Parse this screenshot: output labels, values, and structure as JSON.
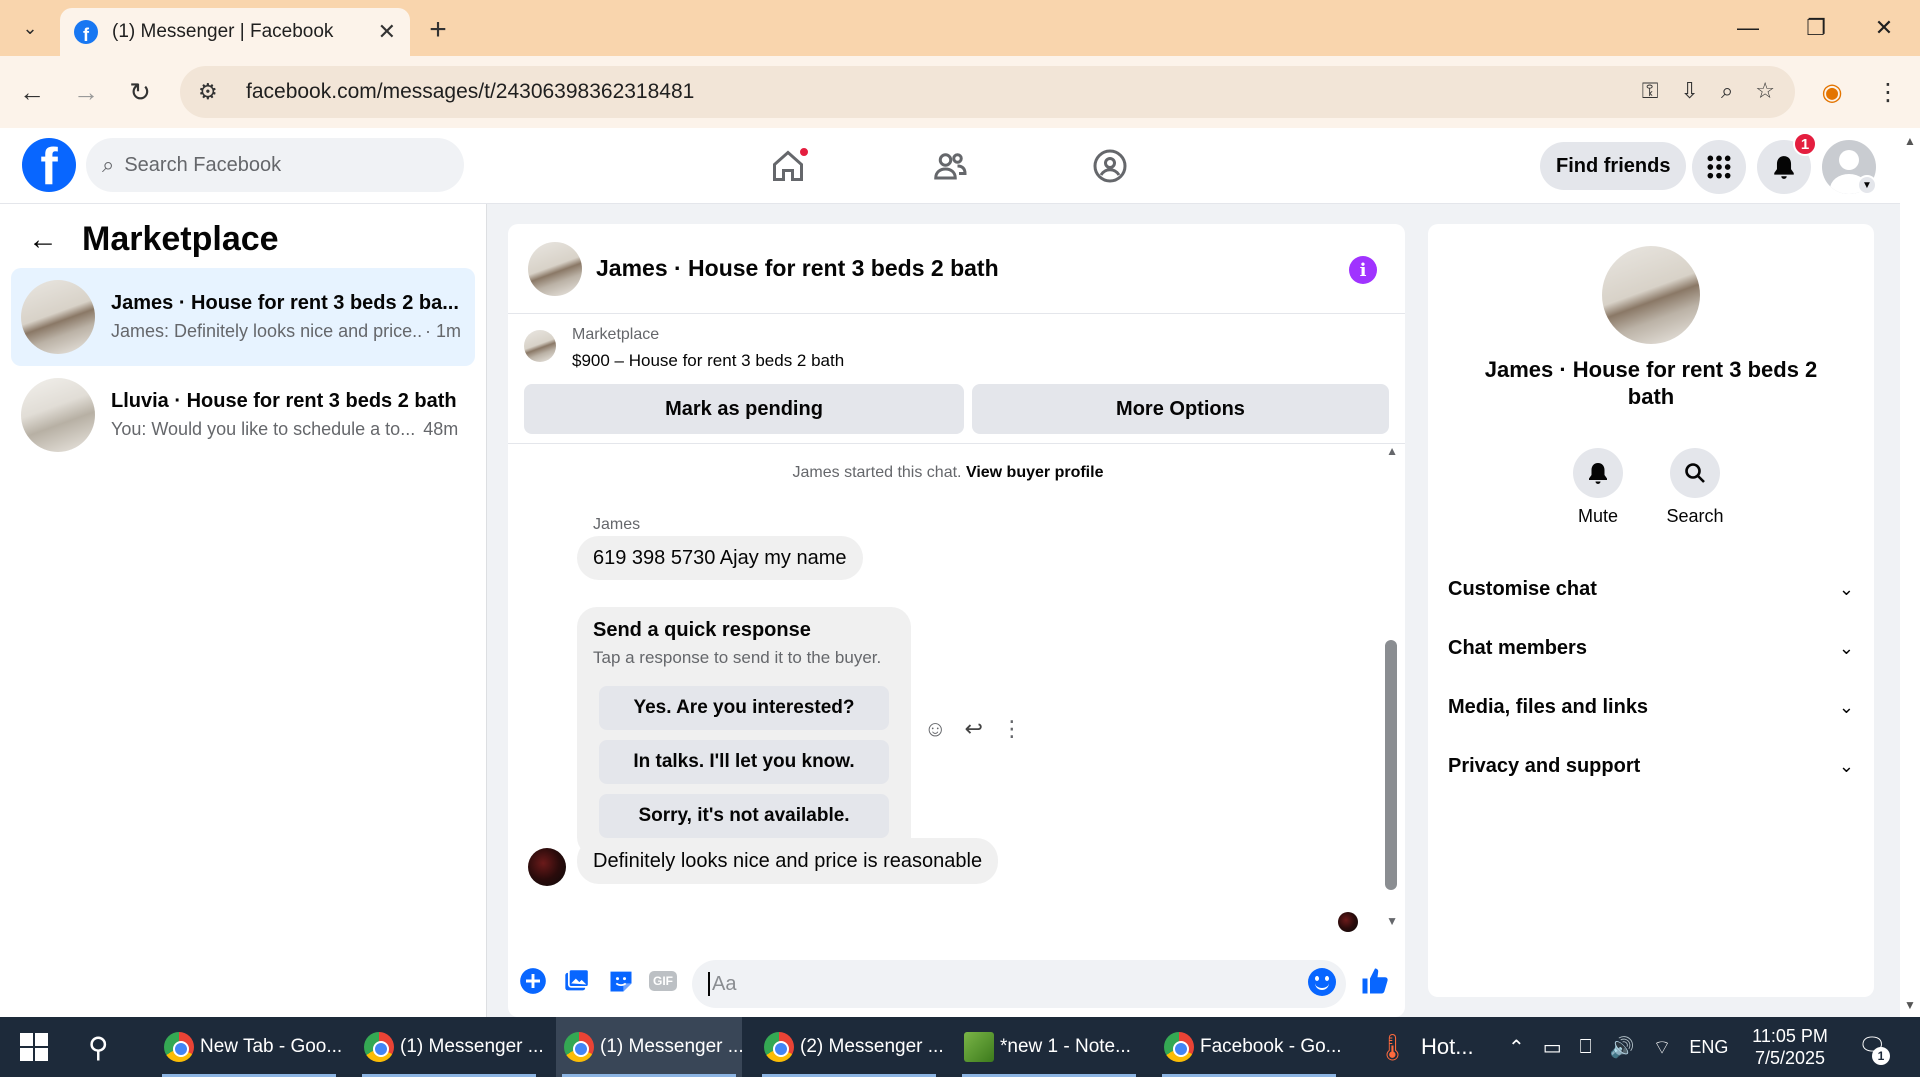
{
  "browser": {
    "tab_title": "(1) Messenger | Facebook",
    "url": "facebook.com/messages/t/24306398362318481"
  },
  "facebook": {
    "search_placeholder": "Search Facebook",
    "find_friends_label": "Find friends",
    "notifications_count": "1"
  },
  "sidebar": {
    "title": "Marketplace",
    "conversations": [
      {
        "name": "James · House for rent 3 beds 2 ba...",
        "snippet": "James: Definitely looks nice and price...",
        "time": "· 1m",
        "active": true
      },
      {
        "name": "Lluvia · House for rent 3 beds 2 bath",
        "snippet": "You: Would you like to schedule a to...",
        "time": "48m",
        "active": false
      }
    ]
  },
  "chat": {
    "title": "James · House for rent 3 beds 2 bath",
    "listing": {
      "category": "Marketplace",
      "item": "$900 – House for rent 3 beds 2 bath",
      "mark_pending_label": "Mark as pending",
      "more_options_label": "More Options"
    },
    "system_text": "James started this chat.",
    "system_link": "View buyer profile",
    "sender_name": "James",
    "messages": [
      {
        "text": "619 398 5730 Ajay my name"
      },
      {
        "text": "Definitely looks nice and price is reasonable"
      }
    ],
    "quick_response": {
      "title": "Send a quick response",
      "subtitle": "Tap a response to send it to the buyer.",
      "options": [
        "Yes. Are you interested?",
        "In talks. I'll let you know.",
        "Sorry, it's not available."
      ]
    },
    "composer_placeholder": "Aa",
    "gif_label": "GIF"
  },
  "info_panel": {
    "name": "James · House for rent 3 beds 2 bath",
    "actions": [
      {
        "label": "Mute"
      },
      {
        "label": "Search"
      }
    ],
    "sections": [
      "Customise chat",
      "Chat members",
      "Media, files and links",
      "Privacy and support"
    ]
  },
  "taskbar": {
    "apps": [
      {
        "label": "New Tab - Goo..."
      },
      {
        "label": "(1) Messenger ..."
      },
      {
        "label": "(1) Messenger ..."
      },
      {
        "label": "(2) Messenger ..."
      },
      {
        "label": "*new 1 - Note..."
      },
      {
        "label": "Facebook - Go..."
      }
    ],
    "weather_label": "Hot...",
    "language": "ENG",
    "time": "11:05 PM",
    "date": "7/5/2025",
    "notification_count": "1"
  }
}
